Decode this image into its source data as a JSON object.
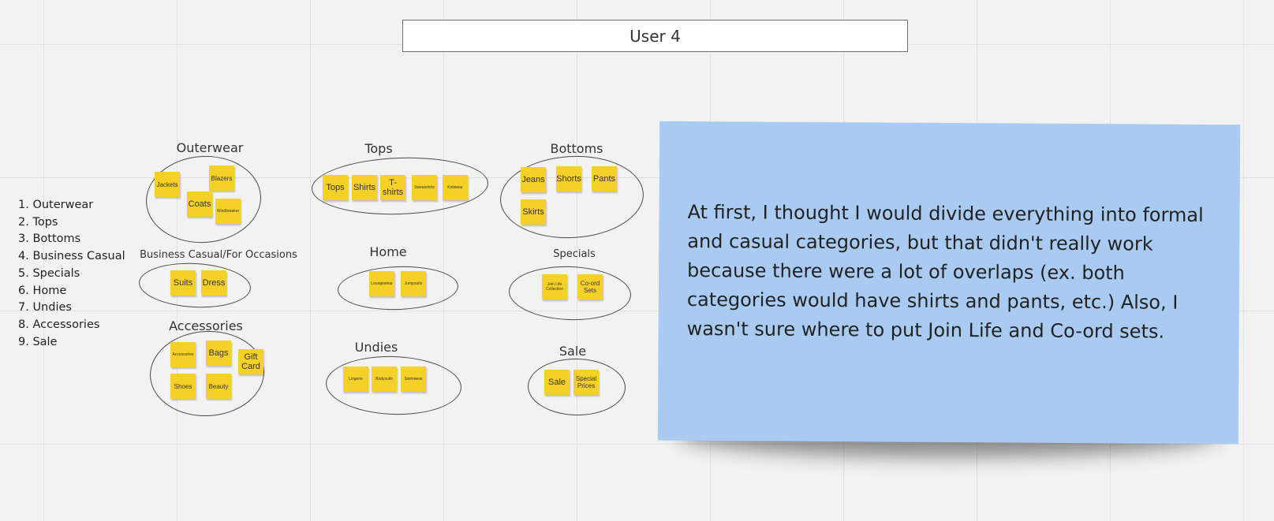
{
  "board": {
    "title": "User 4",
    "list": [
      "1. Outerwear",
      "2. Tops",
      "3. Bottoms",
      "4. Business Casual",
      "5. Specials",
      "6. Home",
      "7. Undies",
      "8. Accessories",
      "9. Sale"
    ]
  },
  "groups": {
    "outerwear": {
      "label": "Outerwear",
      "stickies": [
        "Jackets",
        "Blazers",
        "Coats",
        "Windbreaker"
      ]
    },
    "tops": {
      "label": "Tops",
      "stickies": [
        "Tops",
        "Shirts",
        "T-shirts",
        "Sweatshirts",
        "Knitwear"
      ]
    },
    "bottoms": {
      "label": "Bottoms",
      "stickies": [
        "Jeans",
        "Shorts",
        "Pants",
        "Skirts"
      ]
    },
    "business": {
      "label": "Business Casual/For Occasions",
      "stickies": [
        "Suits",
        "Dress"
      ]
    },
    "home": {
      "label": "Home",
      "stickies": [
        "Loungewear",
        "Jumpsuits"
      ]
    },
    "specials": {
      "label": "Specials",
      "stickies": [
        "Join Life Collection",
        "Co-ord Sets"
      ]
    },
    "accessories": {
      "label": "Accessories",
      "stickies": [
        "Accessories",
        "Bags",
        "Gift Card",
        "Shoes",
        "Beauty"
      ]
    },
    "undies": {
      "label": "Undies",
      "stickies": [
        "Lingerie",
        "Bodysuits",
        "Swimwear"
      ]
    },
    "sale": {
      "label": "Sale",
      "stickies": [
        "Sale",
        "Special Prices"
      ]
    }
  },
  "note": {
    "text": "At first, I thought I would divide everything into formal and casual categories, but that didn't really work because there were a lot of overlaps (ex. both categories would have shirts and pants, etc.) Also, I wasn't sure where to put Join Life and Co-ord sets."
  },
  "colors": {
    "canvas": "#f2f2f2",
    "sticky_yellow": "#f5d128",
    "note_blue": "#a9cbf1"
  }
}
